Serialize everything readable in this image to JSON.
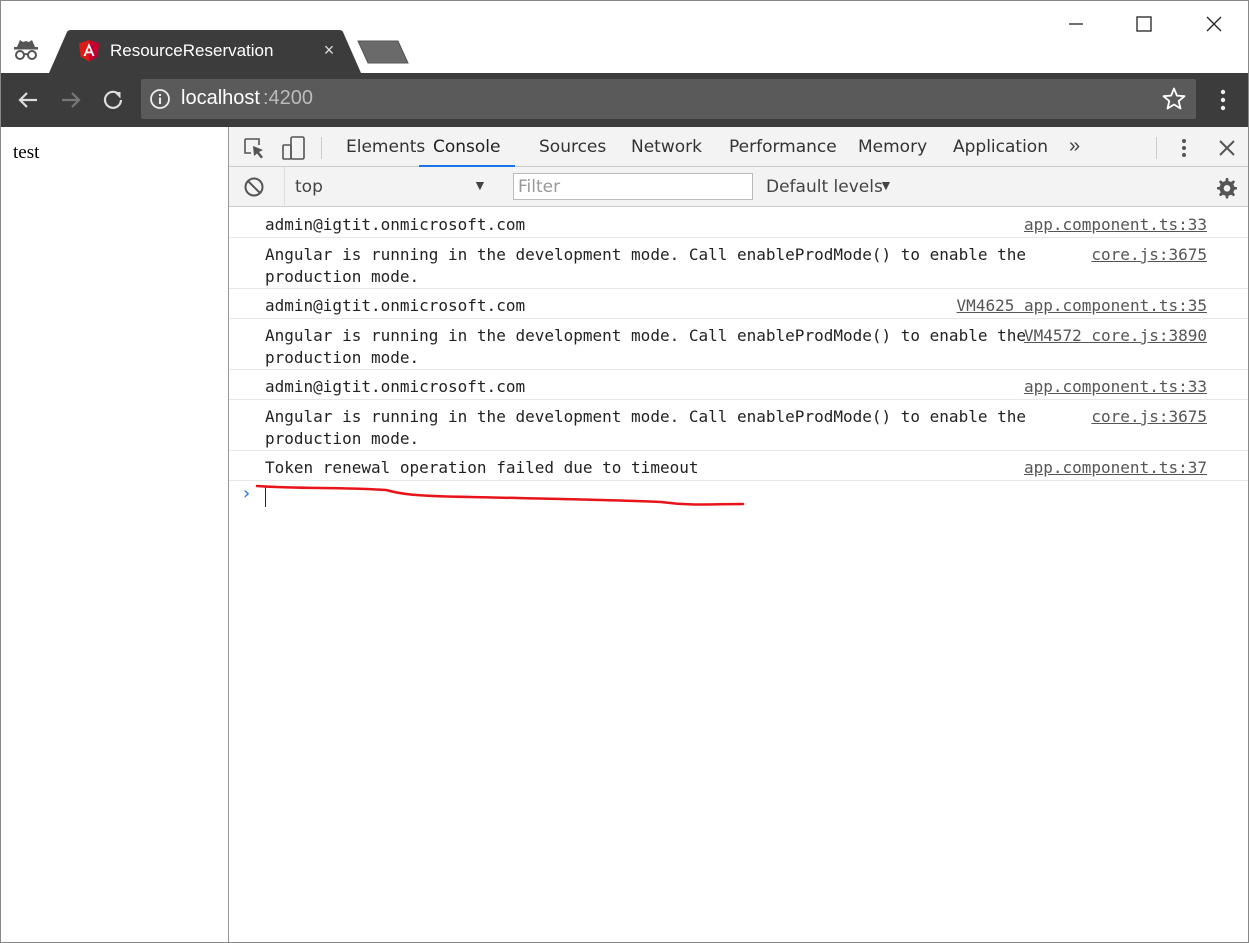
{
  "browser": {
    "tab": {
      "title": "ResourceReservation",
      "close_glyph": "×"
    },
    "url": {
      "host": "localhost",
      "port": ":4200"
    },
    "icons": {
      "incognito": "incognito-icon",
      "favicon": "angular-icon",
      "back": "arrow-left-icon",
      "forward": "arrow-right-icon",
      "reload": "reload-icon",
      "info": "info-icon",
      "star": "star-icon",
      "menu": "kebab-icon"
    },
    "colors": {
      "toolbar": "#3c3c3c",
      "omnibox": "#5a5a5a",
      "tab": "#3c3c3c",
      "angular_red": "#dd1b16"
    }
  },
  "page": {
    "text": "test"
  },
  "devtools": {
    "tabs": [
      "Elements",
      "Console",
      "Sources",
      "Network",
      "Performance",
      "Memory",
      "Application"
    ],
    "active_tab": "Console",
    "more_tabs_glyph": "»",
    "context": {
      "label": "top",
      "arrow": "▼"
    },
    "filter": {
      "placeholder": "Filter",
      "value": ""
    },
    "levels": {
      "label": "Default levels",
      "arrow": "▼"
    },
    "logs": [
      {
        "message": "admin@igtit.onmicrosoft.com",
        "source": "app.component.ts:33"
      },
      {
        "message": "Angular is running in the development mode. Call enableProdMode() to enable the production mode.",
        "source": "core.js:3675"
      },
      {
        "message": "admin@igtit.onmicrosoft.com",
        "source": "VM4625 app.component.ts:35"
      },
      {
        "message": "Angular is running in the development mode. Call enableProdMode() to enable the production mode.",
        "source": "VM4572 core.js:3890"
      },
      {
        "message": "admin@igtit.onmicrosoft.com",
        "source": "app.component.ts:33"
      },
      {
        "message": "Angular is running in the development mode. Call enableProdMode() to enable the production mode.",
        "source": "core.js:3675"
      },
      {
        "message": "Token renewal operation failed due to timeout",
        "source": "app.component.ts:37"
      }
    ],
    "prompt_glyph": "›",
    "annotation_color": "#e8141a"
  }
}
